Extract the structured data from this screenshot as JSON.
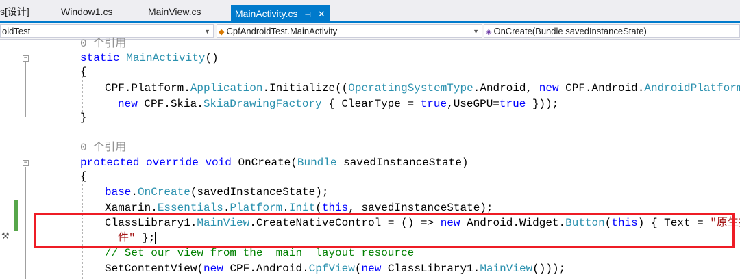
{
  "tabs": [
    {
      "label": "s[设计]"
    },
    {
      "label": "Window1.cs"
    },
    {
      "label": "MainView.cs"
    },
    {
      "label": "MainActivity.cs",
      "active": true,
      "pin": "⊣",
      "close": "✕"
    }
  ],
  "nav": {
    "project": "oidTest",
    "class": "CpfAndroidTest.MainActivity",
    "member": "OnCreate(Bundle savedInstanceState)"
  },
  "code": {
    "ref1": "0 个引用",
    "l1_kw": "static",
    "l1_ty": "MainActivity",
    "l1_rest": "()",
    "brace_open": "{",
    "brace_close": "}",
    "l3_a": "CPF.Platform.",
    "l3_b": "Application",
    "l3_c": ".Initialize((",
    "l3_d": "OperatingSystemType",
    "l3_e": ".Android, ",
    "l3_f": "new",
    "l3_g": " CPF.Android.",
    "l3_h": "AndroidPlatform",
    "l3_i": "(),",
    "l4_a": "new",
    "l4_b": " CPF.Skia.",
    "l4_c": "SkiaDrawingFactory",
    "l4_d": " { ClearType = ",
    "l4_e": "true",
    "l4_f": ",UseGPU=",
    "l4_g": "true",
    "l4_h": " }));",
    "ref2": "0 个引用",
    "l7_a": "protected",
    "l7_b": " override",
    "l7_c": " void",
    "l7_d": " OnCreate(",
    "l7_e": "Bundle",
    "l7_f": " savedInstanceState)",
    "l9_a": "base",
    "l9_b": ".",
    "l9_c": "OnCreate",
    "l9_d": "(savedInstanceState);",
    "l10_a": "Xamarin.",
    "l10_b": "Essentials",
    "l10_c": ".",
    "l10_d": "Platform",
    "l10_e": ".",
    "l10_f": "Init",
    "l10_g": "(",
    "l10_h": "this",
    "l10_i": ", savedInstanceState);",
    "l11_a": "ClassLibrary1.",
    "l11_b": "MainView",
    "l11_c": ".CreateNativeControl = () => ",
    "l11_d": "new",
    "l11_e": " Android.Widget.",
    "l11_f": "Button",
    "l11_g": "(",
    "l11_h": "this",
    "l11_i": ") { Text = ",
    "l11_j": "\"原生控",
    "l12_a": "件\"",
    "l12_b": " };",
    "l13": "// Set our view from the  main  layout resource",
    "l14_a": "SetContentView(",
    "l14_b": "new",
    "l14_c": " CPF.Android.",
    "l14_d": "CpfView",
    "l14_e": "(",
    "l14_f": "new",
    "l14_g": " ClassLibrary1.",
    "l14_h": "MainView",
    "l14_i": "()));",
    "l15": "}"
  },
  "colors": {
    "keyword": "#0000ff",
    "type": "#2b91af",
    "comment": "#008000",
    "string": "#a31515",
    "tab_active": "#007acc",
    "highlight_box": "#ee1c25",
    "change_bar": "#57a64a"
  }
}
